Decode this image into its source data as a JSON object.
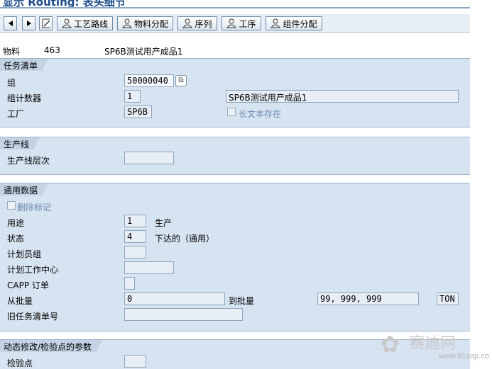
{
  "title": "显示 Routing: 表头细节",
  "toolbar": {
    "items": [
      {
        "label": "工艺路线"
      },
      {
        "label": "物料分配"
      },
      {
        "label": "序列"
      },
      {
        "label": "工序"
      },
      {
        "label": "组件分配"
      }
    ]
  },
  "header": {
    "material_label": "物料",
    "material_value": "463",
    "material_desc": "SP6B测试用产成品1"
  },
  "task_list": {
    "section_title": "任务清单",
    "group_label": "组",
    "group_value": "50000040",
    "counter_label": "组计数器",
    "counter_value": "1",
    "counter_desc": "SP6B测试用产成品1",
    "plant_label": "工厂",
    "plant_value": "SP6B",
    "long_text_label": "长文本存在"
  },
  "production_line": {
    "section_title": "生产线",
    "level_label": "生产线层次",
    "level_value": ""
  },
  "general_data": {
    "section_title": "通用数据",
    "deletion_flag_label": "删除标记",
    "usage_label": "用途",
    "usage_value": "1",
    "usage_desc": "生产",
    "status_label": "状态",
    "status_value": "4",
    "status_desc": "下达的（通用）",
    "planner_group_label": "计划员组",
    "planner_group_value": "",
    "work_center_label": "计划工作中心",
    "work_center_value": "",
    "capp_label": "CAPP 订单",
    "capp_value": "",
    "from_lot_label": "从批量",
    "from_lot_value": "0",
    "to_lot_label": "到批量",
    "to_lot_value": "99, 999, 999",
    "unit_value": "TON",
    "old_task_label": "旧任务清单号",
    "old_task_value": ""
  },
  "dynamic_mod": {
    "section_title": "动态修改/检验点的参数",
    "inspection_point_label": "检验点",
    "inspection_point_value": ""
  },
  "watermark": {
    "text": "赛迪网",
    "url": "www.91sap.co"
  }
}
